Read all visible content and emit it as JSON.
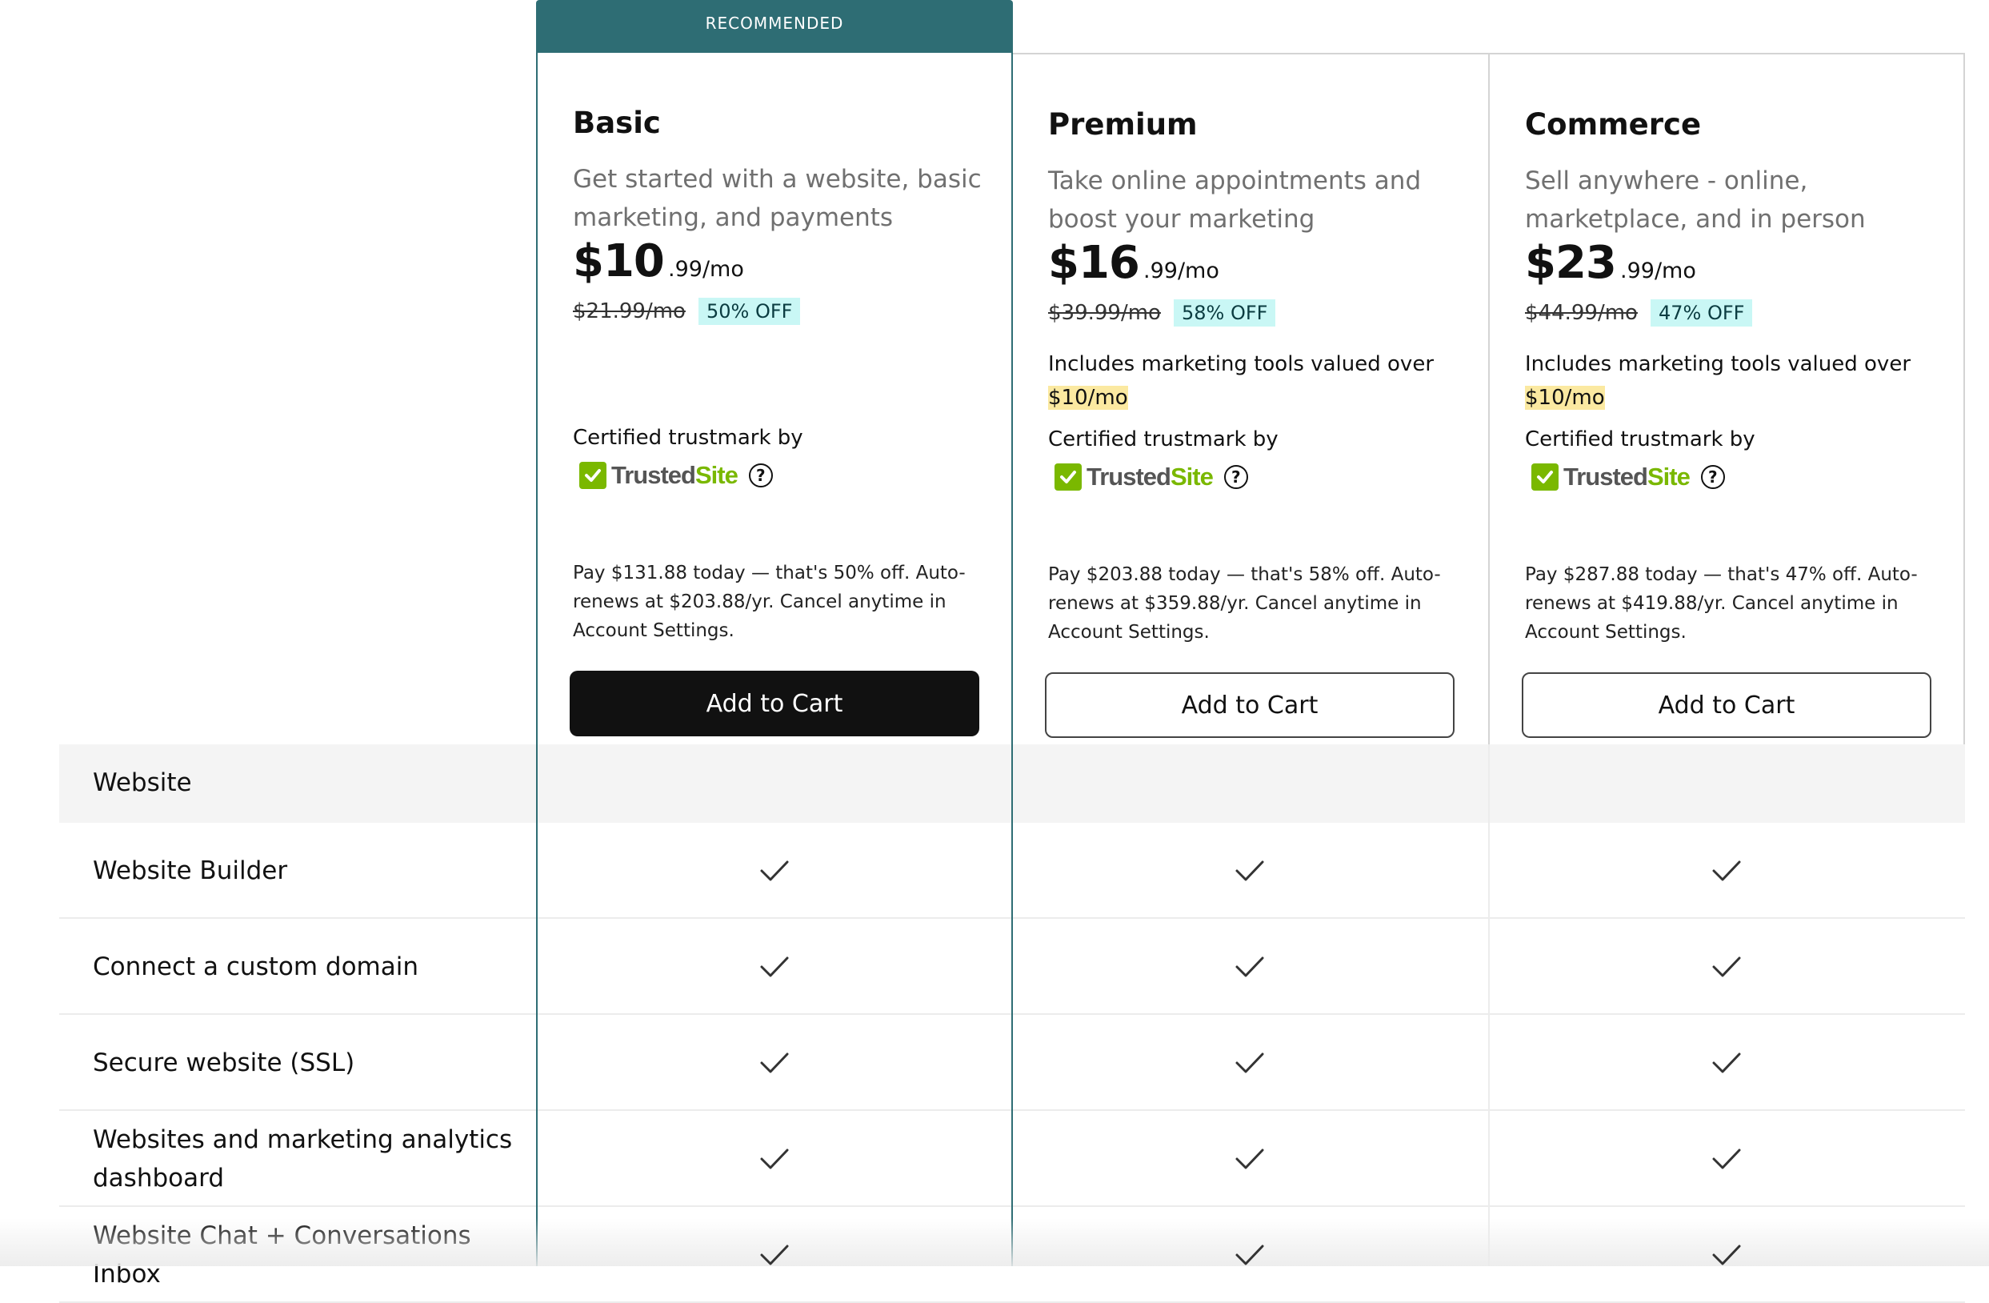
{
  "recommended_label": "RECOMMENDED",
  "plans": [
    {
      "name": "Basic",
      "description": "Get started with a website, basic marketing, and payments",
      "price_main": "$10",
      "price_cents": ".99/mo",
      "old_price": "$21.99/mo",
      "discount": "50% OFF",
      "tools_text": "",
      "tools_value": "",
      "cert_label": "Certified trustmark by",
      "trust_brand_1": "Trusted",
      "trust_brand_2": "Site",
      "terms": "Pay $131.88 today — that's 50% off. Auto-renews at $203.88/yr. Cancel anytime in Account Settings.",
      "cta": "Add to Cart",
      "cta_style": "dark"
    },
    {
      "name": "Premium",
      "description": "Take online appointments and boost your marketing",
      "price_main": "$16",
      "price_cents": ".99/mo",
      "old_price": "$39.99/mo",
      "discount": "58% OFF",
      "tools_text": "Includes marketing tools valued over",
      "tools_value": "$10/mo",
      "cert_label": "Certified trustmark by",
      "trust_brand_1": "Trusted",
      "trust_brand_2": "Site",
      "terms": "Pay $203.88 today — that's 58% off. Auto-renews at $359.88/yr. Cancel anytime in Account Settings.",
      "cta": "Add to Cart",
      "cta_style": "light"
    },
    {
      "name": "Commerce",
      "description": "Sell anywhere - online, marketplace, and in person",
      "price_main": "$23",
      "price_cents": ".99/mo",
      "old_price": "$44.99/mo",
      "discount": "47% OFF",
      "tools_text": "Includes marketing tools valued over",
      "tools_value": "$10/mo",
      "cert_label": "Certified trustmark by",
      "trust_brand_1": "Trusted",
      "trust_brand_2": "Site",
      "terms": "Pay $287.88 today — that's 47% off. Auto-renews at $419.88/yr. Cancel anytime in Account Settings.",
      "cta": "Add to Cart",
      "cta_style": "light"
    }
  ],
  "section_label": "Website",
  "features": [
    {
      "label": "Website Builder",
      "basic": true,
      "premium": true,
      "commerce": true
    },
    {
      "label": "Connect a custom domain",
      "basic": true,
      "premium": true,
      "commerce": true
    },
    {
      "label": "Secure website (SSL)",
      "basic": true,
      "premium": true,
      "commerce": true
    },
    {
      "label": "Websites and marketing analytics dashboard",
      "basic": true,
      "premium": true,
      "commerce": true
    },
    {
      "label": "Website Chat + Conversations Inbox",
      "basic": true,
      "premium": true,
      "commerce": true
    }
  ],
  "colors": {
    "accent": "#2e6d74",
    "badge_bg": "#c9f7f5",
    "highlight": "#fbe9a1",
    "trust_green": "#7ab800"
  },
  "icons": {
    "check": "checkmark-icon",
    "help": "question-circle-icon",
    "trust": "trustedsite-check-icon"
  }
}
